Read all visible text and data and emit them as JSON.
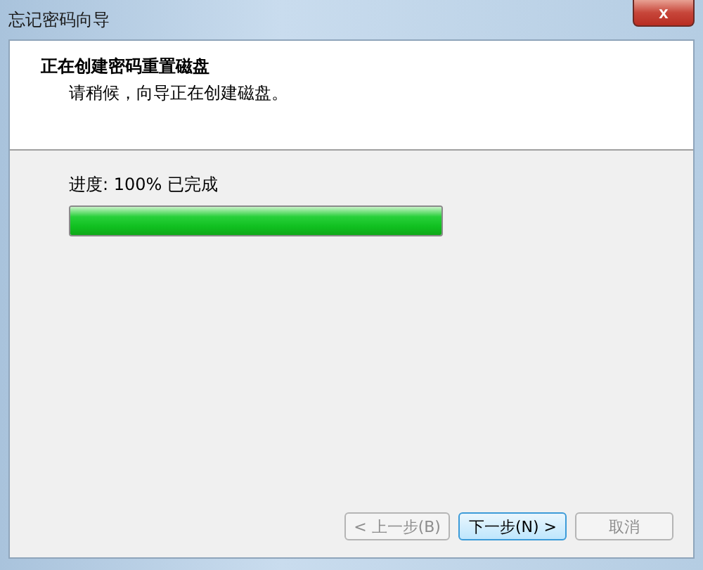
{
  "window": {
    "title": "忘记密码向导",
    "close": "x"
  },
  "header": {
    "title": "正在创建密码重置磁盘",
    "subtitle": "请稍候，向导正在创建磁盘。"
  },
  "progress": {
    "label": "进度: 100% 已完成",
    "level": 1
  },
  "buttons": [
    {
      "label": "< 上一步(B)",
      "disabled": true,
      "focused": false
    },
    {
      "label": "下一步(N) >",
      "disabled": false,
      "focused": true
    },
    {
      "label": "取消",
      "disabled": true,
      "focused": false
    }
  ]
}
